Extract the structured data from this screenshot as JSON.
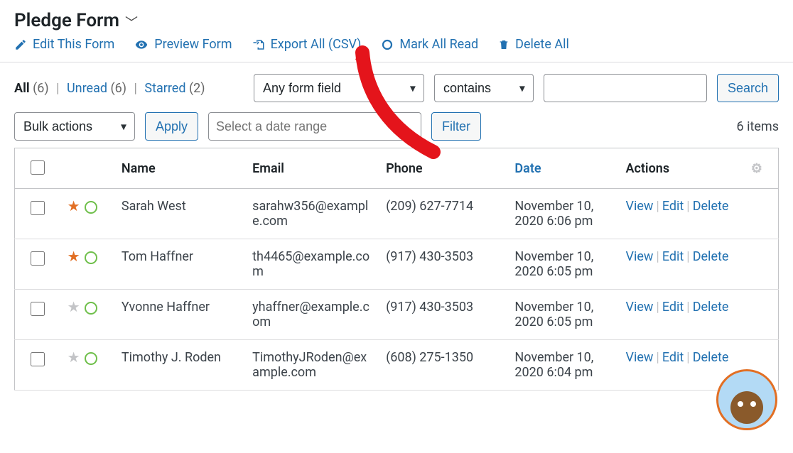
{
  "header": {
    "title": "Pledge Form"
  },
  "toolbar": {
    "edit": "Edit This Form",
    "preview": "Preview Form",
    "export": "Export All (CSV)",
    "mark_read": "Mark All Read",
    "delete_all": "Delete All"
  },
  "filters": {
    "all_label": "All",
    "all_count": "(6)",
    "unread_label": "Unread",
    "unread_count": "(6)",
    "starred_label": "Starred",
    "starred_count": "(2)",
    "any_field": "Any form field",
    "op": "contains",
    "search_value": "",
    "search_btn": "Search",
    "bulk": "Bulk actions",
    "apply": "Apply",
    "date_range_ph": "Select a date range",
    "filter": "Filter",
    "items_count": "6 items"
  },
  "columns": {
    "name": "Name",
    "email": "Email",
    "phone": "Phone",
    "date": "Date",
    "actions": "Actions"
  },
  "row_actions": {
    "view": "View",
    "edit": "Edit",
    "delete": "Delete"
  },
  "rows": [
    {
      "starred": true,
      "name": "Sarah West",
      "email": "sarahw356@example.com",
      "phone": "(209) 627-7714",
      "date": "November 10, 2020 6:06 pm"
    },
    {
      "starred": true,
      "name": "Tom Haffner",
      "email": "th4465@example.com",
      "phone": "(917) 430-3503",
      "date": "November 10, 2020 6:05 pm"
    },
    {
      "starred": false,
      "name": "Yvonne Haffner",
      "email": "yhaffner@example.com",
      "phone": "(917) 430-3503",
      "date": "November 10, 2020 6:05 pm"
    },
    {
      "starred": false,
      "name": "Timothy J. Roden",
      "email": "TimothyJRoden@example.com",
      "phone": "(608) 275-1350",
      "date": "November 10, 2020 6:04 pm"
    }
  ]
}
